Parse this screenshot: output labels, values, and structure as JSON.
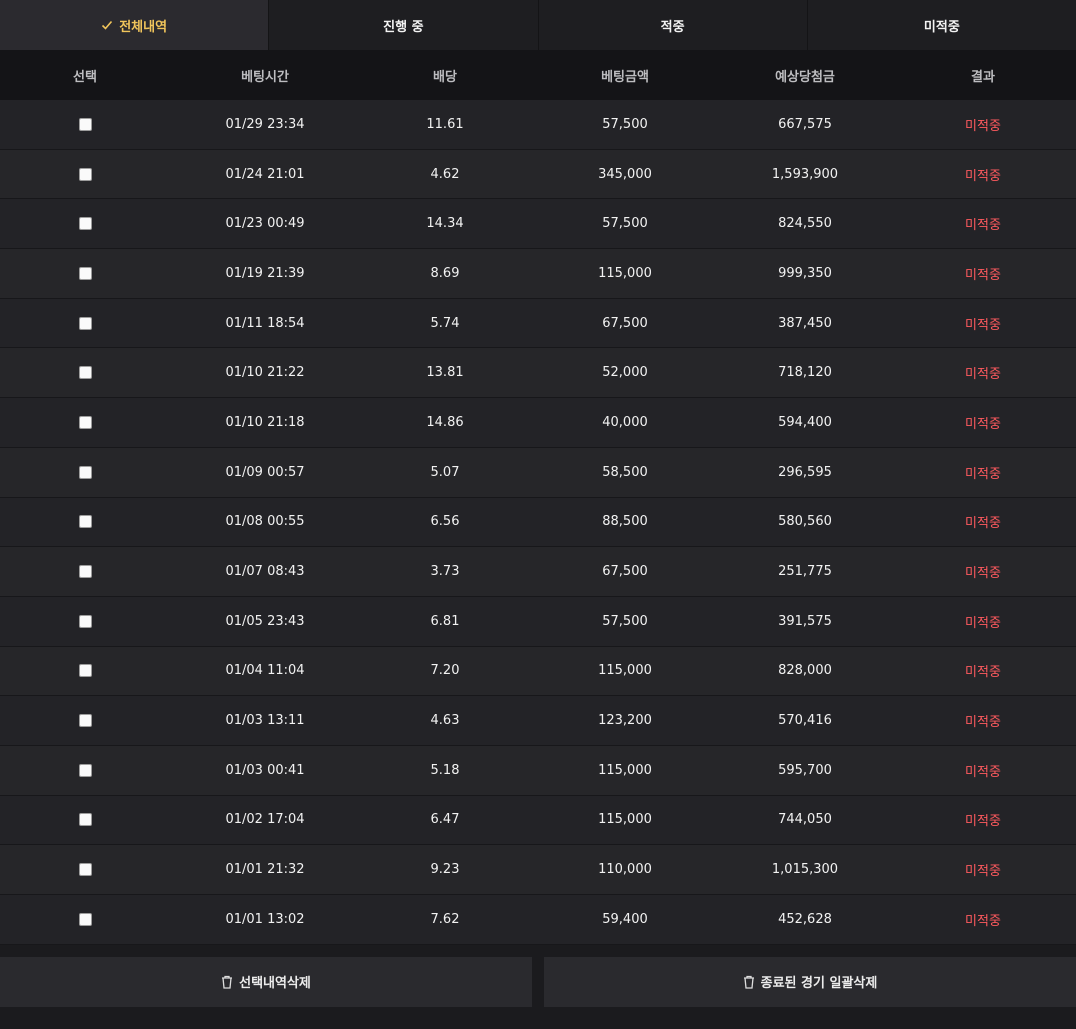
{
  "tabs": [
    {
      "label": "전체내역"
    },
    {
      "label": "진행 중"
    },
    {
      "label": "적중"
    },
    {
      "label": "미적중"
    }
  ],
  "headers": [
    "선택",
    "베팅시간",
    "배당",
    "베팅금액",
    "예상당첨금",
    "결과"
  ],
  "rows": [
    {
      "time": "01/29 23:34",
      "odds": "11.61",
      "amount": "57,500",
      "payout": "667,575",
      "result": "미적중"
    },
    {
      "time": "01/24 21:01",
      "odds": "4.62",
      "amount": "345,000",
      "payout": "1,593,900",
      "result": "미적중"
    },
    {
      "time": "01/23 00:49",
      "odds": "14.34",
      "amount": "57,500",
      "payout": "824,550",
      "result": "미적중"
    },
    {
      "time": "01/19 21:39",
      "odds": "8.69",
      "amount": "115,000",
      "payout": "999,350",
      "result": "미적중"
    },
    {
      "time": "01/11 18:54",
      "odds": "5.74",
      "amount": "67,500",
      "payout": "387,450",
      "result": "미적중"
    },
    {
      "time": "01/10 21:22",
      "odds": "13.81",
      "amount": "52,000",
      "payout": "718,120",
      "result": "미적중"
    },
    {
      "time": "01/10 21:18",
      "odds": "14.86",
      "amount": "40,000",
      "payout": "594,400",
      "result": "미적중"
    },
    {
      "time": "01/09 00:57",
      "odds": "5.07",
      "amount": "58,500",
      "payout": "296,595",
      "result": "미적중"
    },
    {
      "time": "01/08 00:55",
      "odds": "6.56",
      "amount": "88,500",
      "payout": "580,560",
      "result": "미적중"
    },
    {
      "time": "01/07 08:43",
      "odds": "3.73",
      "amount": "67,500",
      "payout": "251,775",
      "result": "미적중"
    },
    {
      "time": "01/05 23:43",
      "odds": "6.81",
      "amount": "57,500",
      "payout": "391,575",
      "result": "미적중"
    },
    {
      "time": "01/04 11:04",
      "odds": "7.20",
      "amount": "115,000",
      "payout": "828,000",
      "result": "미적중"
    },
    {
      "time": "01/03 13:11",
      "odds": "4.63",
      "amount": "123,200",
      "payout": "570,416",
      "result": "미적중"
    },
    {
      "time": "01/03 00:41",
      "odds": "5.18",
      "amount": "115,000",
      "payout": "595,700",
      "result": "미적중"
    },
    {
      "time": "01/02 17:04",
      "odds": "6.47",
      "amount": "115,000",
      "payout": "744,050",
      "result": "미적중"
    },
    {
      "time": "01/01 21:32",
      "odds": "9.23",
      "amount": "110,000",
      "payout": "1,015,300",
      "result": "미적중"
    },
    {
      "time": "01/01 13:02",
      "odds": "7.62",
      "amount": "59,400",
      "payout": "452,628",
      "result": "미적중"
    }
  ],
  "footer": {
    "delete_selected_label": "선택내역삭제",
    "delete_finished_label": "종료된 경기 일괄삭제"
  },
  "colors": {
    "accent": "#f1c55b",
    "lose": "#ff5a5f"
  },
  "icons": {
    "active_tab": "check-icon",
    "delete": "trash-icon"
  }
}
